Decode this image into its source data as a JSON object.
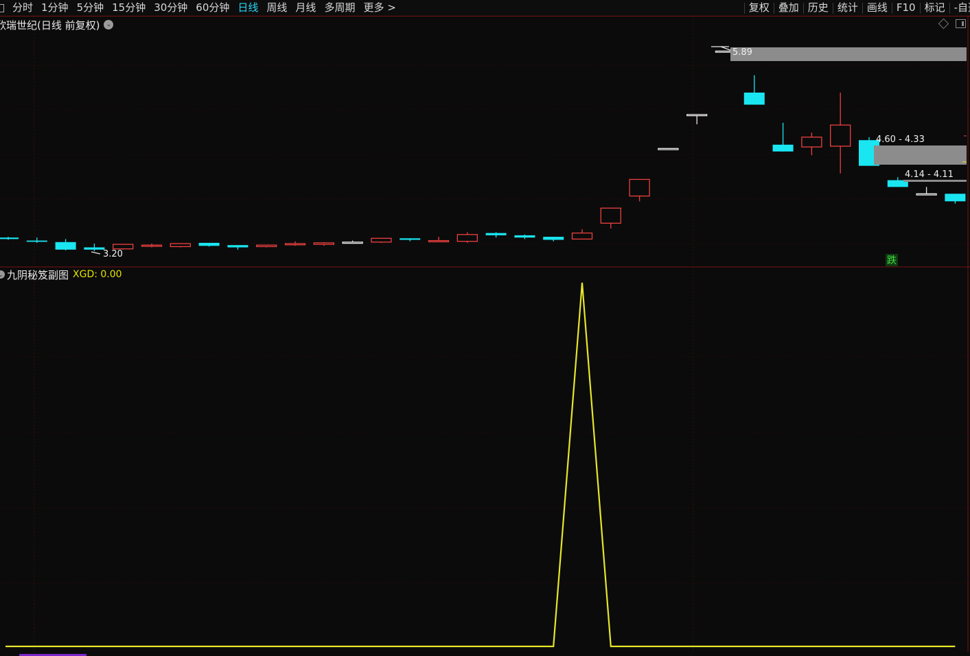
{
  "toolbar": {
    "period_tabs": [
      "分时",
      "1分钟",
      "5分钟",
      "15分钟",
      "30分钟",
      "60分钟",
      "日线",
      "周线",
      "月线",
      "多周期",
      "更多 >"
    ],
    "active_tab": "日线",
    "right_items": [
      "复权",
      "叠加",
      "历史",
      "统计",
      "画线",
      "F10",
      "标记",
      "-自选"
    ]
  },
  "main_chart": {
    "title": "欣瑞世纪(日线 前复权)",
    "high_label": "5.89",
    "low_label": "3.20",
    "zone_upper_label": "4.60 - 4.33",
    "zone_lower_label": "4.14 - 4.11",
    "signal_badge": "跌",
    "colors": {
      "up": "#ee4040",
      "down": "#1ae6f2",
      "flat": "#e6e6e6",
      "zone": "#8c8c8c"
    }
  },
  "sub_chart": {
    "title": "九阴秘笈副图",
    "value_label": "XGD: 0.00",
    "line_color": "#e6e62a"
  },
  "chart_data": {
    "type": "candlestick",
    "candles": [
      {
        "o": 3.38,
        "c": 3.36,
        "h": 3.39,
        "l": 3.35
      },
      {
        "o": 3.34,
        "c": 3.33,
        "h": 3.38,
        "l": 3.31
      },
      {
        "o": 3.32,
        "c": 3.22,
        "h": 3.36,
        "l": 3.21
      },
      {
        "o": 3.25,
        "c": 3.22,
        "h": 3.3,
        "l": 3.2
      },
      {
        "o": 3.23,
        "c": 3.29,
        "h": 3.29,
        "l": 3.22
      },
      {
        "o": 3.27,
        "c": 3.28,
        "h": 3.3,
        "l": 3.25
      },
      {
        "o": 3.26,
        "c": 3.3,
        "h": 3.3,
        "l": 3.25
      },
      {
        "o": 3.31,
        "c": 3.27,
        "h": 3.31,
        "l": 3.26
      },
      {
        "o": 3.28,
        "c": 3.25,
        "h": 3.28,
        "l": 3.22
      },
      {
        "o": 3.26,
        "c": 3.28,
        "h": 3.28,
        "l": 3.25
      },
      {
        "o": 3.29,
        "c": 3.3,
        "h": 3.33,
        "l": 3.27
      },
      {
        "o": 3.29,
        "c": 3.31,
        "h": 3.32,
        "l": 3.27
      },
      {
        "o": 3.32,
        "c": 3.32,
        "h": 3.34,
        "l": 3.3
      },
      {
        "o": 3.32,
        "c": 3.37,
        "h": 3.37,
        "l": 3.31
      },
      {
        "o": 3.37,
        "c": 3.35,
        "h": 3.37,
        "l": 3.33
      },
      {
        "o": 3.33,
        "c": 3.34,
        "h": 3.39,
        "l": 3.33
      },
      {
        "o": 3.33,
        "c": 3.42,
        "h": 3.45,
        "l": 3.31
      },
      {
        "o": 3.44,
        "c": 3.41,
        "h": 3.45,
        "l": 3.38
      },
      {
        "o": 3.41,
        "c": 3.38,
        "h": 3.42,
        "l": 3.36
      },
      {
        "o": 3.39,
        "c": 3.35,
        "h": 3.39,
        "l": 3.33
      },
      {
        "o": 3.36,
        "c": 3.44,
        "h": 3.49,
        "l": 3.36
      },
      {
        "o": 3.57,
        "c": 3.77,
        "h": 3.77,
        "l": 3.5
      },
      {
        "o": 3.93,
        "c": 4.15,
        "h": 4.15,
        "l": 3.86
      },
      {
        "o": 4.56,
        "c": 4.56,
        "h": 4.56,
        "l": 4.56
      },
      {
        "o": 5.01,
        "c": 5.01,
        "h": 5.01,
        "l": 4.88
      },
      {
        "o": 5.85,
        "c": 5.85,
        "h": 5.85,
        "l": 5.85
      },
      {
        "o": 5.3,
        "c": 5.14,
        "h": 5.53,
        "l": 5.14
      },
      {
        "o": 4.61,
        "c": 4.52,
        "h": 4.9,
        "l": 4.52
      },
      {
        "o": 4.58,
        "c": 4.71,
        "h": 4.77,
        "l": 4.47
      },
      {
        "o": 4.59,
        "c": 4.87,
        "h": 5.3,
        "l": 4.23
      },
      {
        "o": 4.67,
        "c": 4.33,
        "h": 4.71,
        "l": 4.33
      },
      {
        "o": 4.14,
        "c": 4.05,
        "h": 4.18,
        "l": 4.05
      },
      {
        "o": 3.96,
        "c": 3.96,
        "h": 4.05,
        "l": 3.96
      },
      {
        "o": 3.96,
        "c": 3.86,
        "h": 3.96,
        "l": 3.83
      }
    ],
    "xgd": [
      0,
      0,
      0,
      0,
      0,
      0,
      0,
      0,
      0,
      0,
      0,
      0,
      0,
      0,
      0,
      0,
      0,
      0,
      0,
      0,
      1,
      0,
      0,
      0,
      0,
      0,
      0,
      0,
      0,
      0,
      0,
      0,
      0,
      0
    ]
  }
}
